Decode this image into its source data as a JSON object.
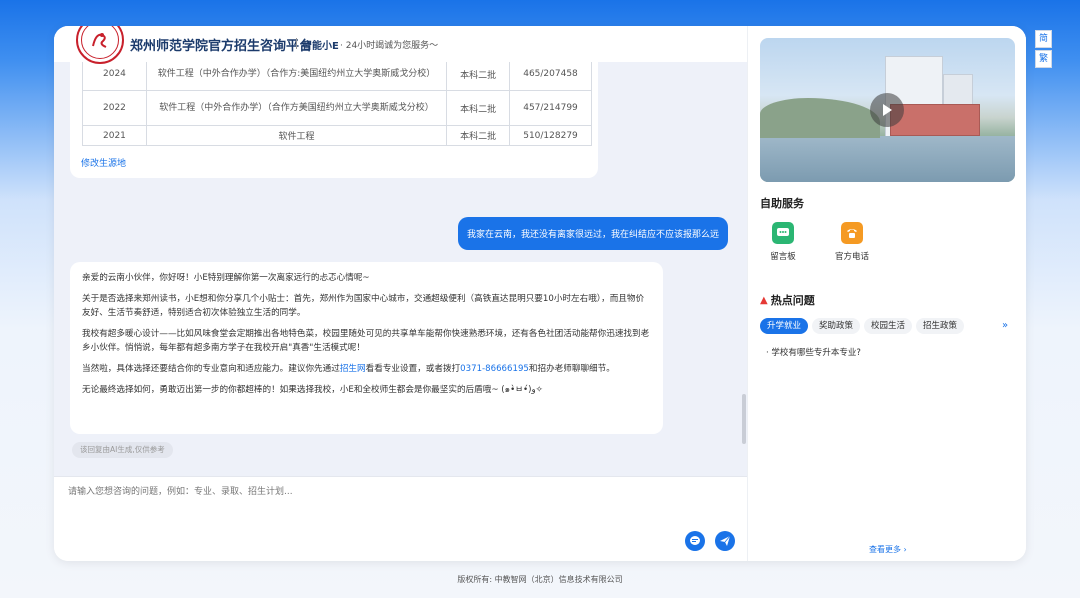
{
  "header": {
    "title": "郑州师范学院官方招生咨询平台",
    "brand": "智能小E",
    "slogan": "· 24小时竭诚为您服务～"
  },
  "table": {
    "rows": [
      {
        "year": "2024",
        "major": "软件工程（中外合作办学）（合作方:美国纽约州立大学奥斯威戈分校）",
        "batch": "本科二批",
        "score": "465/207458"
      },
      {
        "year": "2022",
        "major": "软件工程（中外合作办学）（合作方美国纽约州立大学奥斯威戈分校）",
        "batch": "本科二批",
        "score": "457/214799"
      },
      {
        "year": "2021",
        "major": "软件工程",
        "batch": "本科二批",
        "score": "510/128279"
      }
    ],
    "edit_link": "修改生源地"
  },
  "user_message": "我家在云南，我还没有离家很远过，我在纠结应不应该报那么远",
  "ai_reply": {
    "p1": "亲爱的云南小伙伴，你好呀！小E特别理解你第一次离家远行的忐忑心情呢~",
    "p2": "关于是否选择来郑州读书，小E想和你分享几个小贴士：首先，郑州作为国家中心城市，交通超级便利（高铁直达昆明只要10小时左右哦），而且物价友好、生活节奏舒适，特别适合初次体验独立生活的同学。",
    "p3": "我校有超多暖心设计——比如风味食堂会定期推出各地特色菜，校园里随处可见的共享单车能帮你快速熟悉环境，还有各色社团活动能帮你迅速找到老乡小伙伴。悄悄说，每年都有超多南方学子在我校开启\"真香\"生活模式呢！",
    "p4_before": "当然啦，具体选择还要结合你的专业意向和适应能力。建议你先通过",
    "p4_link": "招生网",
    "p4_middle": "看看专业设置，或者拨打",
    "p4_phone": "0371-86666195",
    "p4_after": "和招办老师聊聊细节。",
    "p5": "无论最终选择如何，勇敢迈出第一步的你都超棒的！如果选择我校，小E和全校师生都会是你最坚实的后盾哦~ (๑•̀ㅂ•́)و✧",
    "tag": "该回复由AI生成,仅供参考"
  },
  "input": {
    "placeholder": "请输入您想咨询的问题，例如：专业、录取、招生计划..."
  },
  "sidebar": {
    "self_service_title": "自助服务",
    "services": [
      {
        "label": "留言板",
        "icon": "message-board-icon",
        "color": "#2bb673"
      },
      {
        "label": "官方电话",
        "icon": "phone-icon",
        "color": "#f59a23"
      }
    ],
    "hot_title": "热点问题",
    "hot_tabs": [
      "升学就业",
      "奖助政策",
      "校园生活",
      "招生政策"
    ],
    "hot_question": "学校有哪些专升本专业?",
    "see_more": "查看更多"
  },
  "lang": {
    "simplified": "简",
    "traditional": "繁"
  },
  "footer": "版权所有: 中教智网（北京）信息技术有限公司",
  "colors": {
    "accent": "#1a73e8",
    "brand_red": "#c8202b"
  }
}
